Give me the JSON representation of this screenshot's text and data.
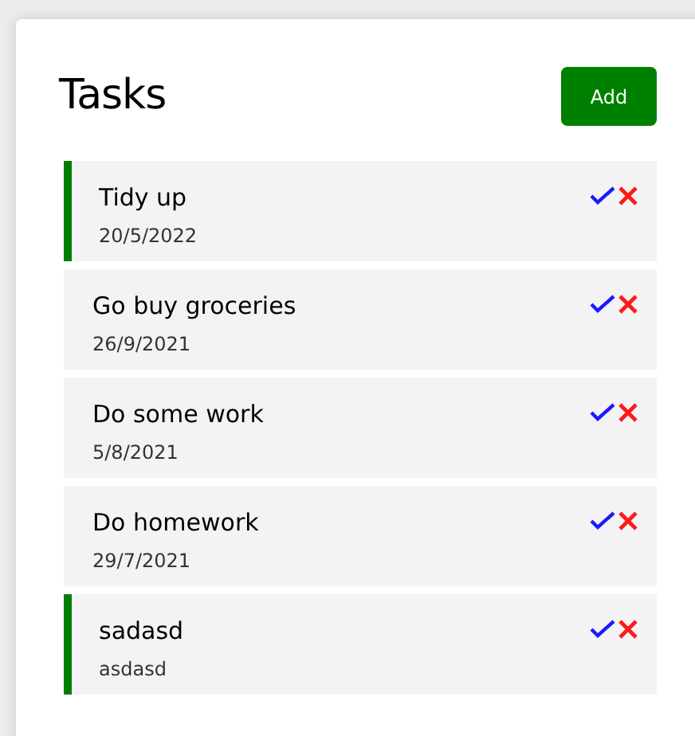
{
  "header": {
    "title": "Tasks",
    "add_button": "Add"
  },
  "tasks": [
    {
      "text": "Tidy up",
      "day": "20/5/2022",
      "reminder": true
    },
    {
      "text": "Go buy groceries",
      "day": "26/9/2021",
      "reminder": false
    },
    {
      "text": "Do some work",
      "day": "5/8/2021",
      "reminder": false
    },
    {
      "text": "Do homework",
      "day": "29/7/2021",
      "reminder": false
    },
    {
      "text": "sadasd",
      "day": "asdasd",
      "reminder": true
    }
  ]
}
